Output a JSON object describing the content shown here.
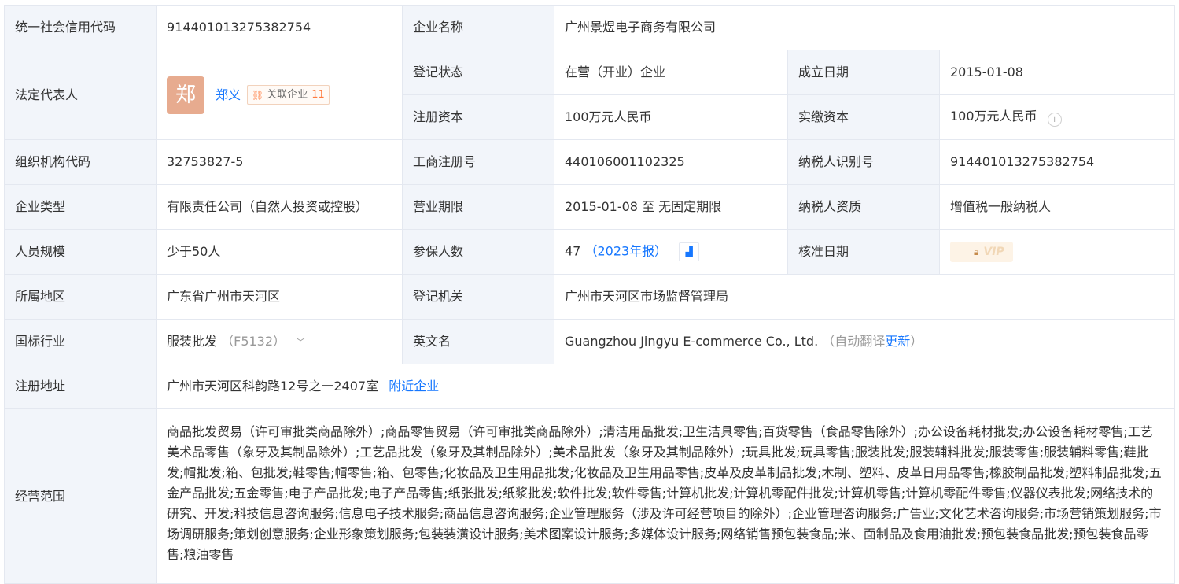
{
  "labels": {
    "credit_code": "统一社会信用代码",
    "company_name": "企业名称",
    "legal_rep": "法定代表人",
    "reg_status": "登记状态",
    "found_date": "成立日期",
    "reg_capital": "注册资本",
    "paid_capital": "实缴资本",
    "org_code": "组织机构代码",
    "biz_reg_no": "工商注册号",
    "taxpayer_id": "纳税人识别号",
    "company_type": "企业类型",
    "biz_term": "营业期限",
    "taxpayer_qual": "纳税人资质",
    "staff_size": "人员规模",
    "insured": "参保人数",
    "approve_date": "核准日期",
    "region": "所属地区",
    "reg_authority": "登记机关",
    "industry": "国标行业",
    "english_name": "英文名",
    "reg_address": "注册地址",
    "biz_scope": "经营范围"
  },
  "values": {
    "credit_code": "914401013275382754",
    "company_name": "广州景煜电子商务有限公司",
    "legal_rep": {
      "avatar_char": "郑",
      "name": "郑义",
      "related_label": "关联企业",
      "related_count": "11"
    },
    "reg_status": "在营（开业）企业",
    "found_date": "2015-01-08",
    "reg_capital": "100万元人民币",
    "paid_capital": "100万元人民币",
    "org_code": "32753827-5",
    "biz_reg_no": "440106001102325",
    "taxpayer_id": "914401013275382754",
    "company_type": "有限责任公司（自然人投资或控股）",
    "biz_term": "2015-01-08 至 无固定期限",
    "taxpayer_qual": "增值税一般纳税人",
    "staff_size": "少于50人",
    "insured": {
      "count": "47",
      "report": "（2023年报）"
    },
    "approve_date": {
      "badge_text": "VIP"
    },
    "region": "广东省广州市天河区",
    "reg_authority": "广州市天河区市场监督管理局",
    "industry": {
      "name": "服装批发",
      "code": "（F5132）"
    },
    "english_name": {
      "name": "Guangzhou Jingyu E-commerce Co., Ltd.",
      "note_prefix": "（自动翻译",
      "update_link": "更新",
      "note_suffix": "）"
    },
    "reg_address": {
      "address": "广州市天河区科韵路12号之一2407室",
      "nearby_link": "附近企业"
    },
    "biz_scope": "商品批发贸易（许可审批类商品除外）;商品零售贸易（许可审批类商品除外）;清洁用品批发;卫生洁具零售;百货零售（食品零售除外）;办公设备耗材批发;办公设备耗材零售;工艺美术品零售（象牙及其制品除外）;工艺品批发（象牙及其制品除外）;美术品批发（象牙及其制品除外）;玩具批发;玩具零售;服装批发;服装辅料批发;服装零售;服装辅料零售;鞋批发;帽批发;箱、包批发;鞋零售;帽零售;箱、包零售;化妆品及卫生用品批发;化妆品及卫生用品零售;皮革及皮革制品批发;木制、塑料、皮革日用品零售;橡胶制品批发;塑料制品批发;五金产品批发;五金零售;电子产品批发;电子产品零售;纸张批发;纸浆批发;软件批发;软件零售;计算机批发;计算机零配件批发;计算机零售;计算机零配件零售;仪器仪表批发;网络技术的研究、开发;科技信息咨询服务;信息电子技术服务;商品信息咨询服务;企业管理服务（涉及许可经营项目的除外）;企业管理咨询服务;广告业;文化艺术咨询服务;市场营销策划服务;市场调研服务;策划创意服务;企业形象策划服务;包装装潢设计服务;美术图案设计服务;多媒体设计服务;网络销售预包装食品;米、面制品及食用油批发;预包装食品批发;预包装食品零售;粮油零售"
  },
  "icons": {
    "info": "info-circle-icon",
    "chart": "trend-chart-icon",
    "lock": "lock-icon",
    "chevron": "chevron-down-icon",
    "related": "related-network-icon"
  },
  "colors": {
    "label_bg": "#f2f5fa",
    "border": "#e4e8f0",
    "link": "#1677ff",
    "avatar_bg": "#e7ab8f",
    "accent_orange": "#ff7a3d"
  }
}
